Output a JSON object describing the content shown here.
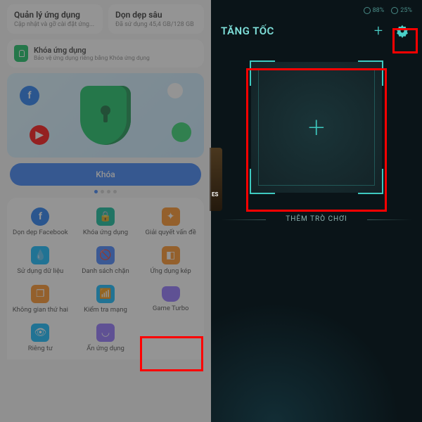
{
  "left": {
    "cards": [
      {
        "title": "Quản lý ứng dụng",
        "sub": "Cập nhật và gỡ cài đặt ứng..."
      },
      {
        "title": "Dọn dẹp sâu",
        "sub": "Đã sử dụng 45,4 GB/128 GB"
      }
    ],
    "lockBanner": {
      "title": "Khóa ứng dụng",
      "sub": "Bảo vệ ứng dụng riêng bằng Khóa ứng dụng"
    },
    "lockButton": "Khóa",
    "tools": [
      {
        "label": "Dọn dẹp Facebook"
      },
      {
        "label": "Khóa ứng dụng"
      },
      {
        "label": "Giải quyết vấn đề"
      },
      {
        "label": "Sử dụng dữ liệu"
      },
      {
        "label": "Danh sách chặn"
      },
      {
        "label": "Ứng dụng kép"
      },
      {
        "label": "Không gian thứ hai"
      },
      {
        "label": "Kiểm tra mạng"
      },
      {
        "label": "Game Turbo"
      },
      {
        "label": "Riêng tư"
      },
      {
        "label": "Ẩn ứng dụng"
      }
    ]
  },
  "right": {
    "stats": {
      "batteryLike": "88%",
      "other": "25%"
    },
    "title": "TĂNG TỐC",
    "addGame": "THÊM TRÒ CHƠI",
    "partialGameHint": "ES"
  }
}
